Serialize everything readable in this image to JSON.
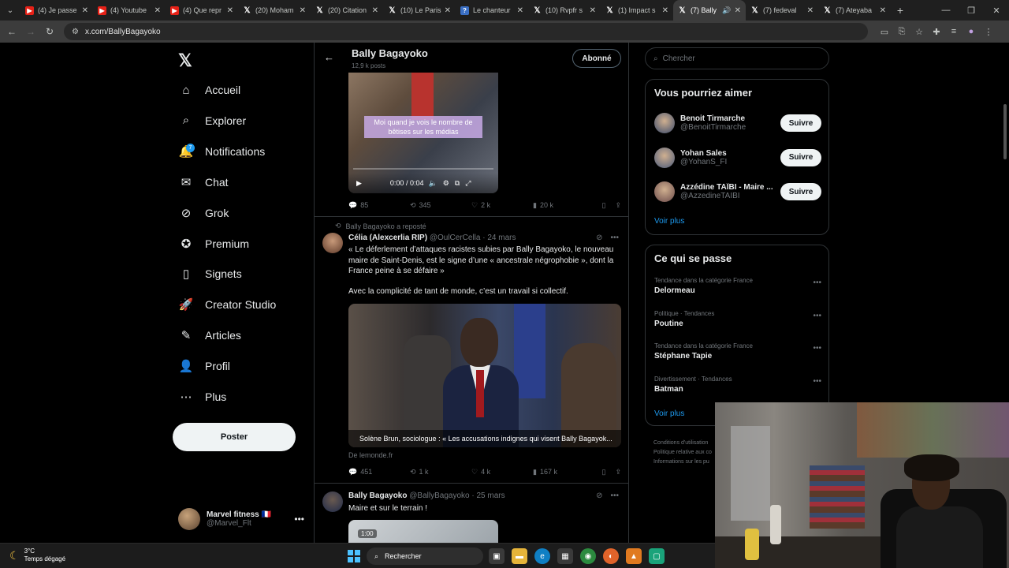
{
  "browser": {
    "tabs": [
      {
        "favicon": "youtube-icon",
        "label": "(4) Je passe"
      },
      {
        "favicon": "youtube-icon",
        "label": "(4) Youtube"
      },
      {
        "favicon": "youtube-icon",
        "label": "(4) Que repr"
      },
      {
        "favicon": "x-icon",
        "label": "(20) Moham"
      },
      {
        "favicon": "x-icon",
        "label": "(20) Citation"
      },
      {
        "favicon": "x-icon",
        "label": "(10) Le Paris"
      },
      {
        "favicon": "wiki-icon",
        "label": "Le chanteur"
      },
      {
        "favicon": "x-icon",
        "label": "(10) Rvpfr s"
      },
      {
        "favicon": "x-icon",
        "label": "(1) Impact s"
      },
      {
        "favicon": "x-icon",
        "label": "(7) Bally"
      },
      {
        "favicon": "x-icon",
        "label": "(7) fedeval"
      },
      {
        "favicon": "x-icon",
        "label": "(7) Ateyaba"
      }
    ],
    "active_tab_index": 9,
    "url": "x.com/BallyBagayoko"
  },
  "nav": {
    "items": [
      {
        "label": "Accueil",
        "icon": "home-icon"
      },
      {
        "label": "Explorer",
        "icon": "search-icon"
      },
      {
        "label": "Notifications",
        "icon": "bell-icon",
        "badge": "7"
      },
      {
        "label": "Chat",
        "icon": "mail-icon"
      },
      {
        "label": "Grok",
        "icon": "grok-icon"
      },
      {
        "label": "Premium",
        "icon": "premium-icon"
      },
      {
        "label": "Signets",
        "icon": "bookmark-icon"
      },
      {
        "label": "Creator Studio",
        "icon": "rocket-icon"
      },
      {
        "label": "Articles",
        "icon": "articles-icon"
      },
      {
        "label": "Profil",
        "icon": "profile-icon"
      },
      {
        "label": "Plus",
        "icon": "more-circle-icon"
      }
    ],
    "post_label": "Poster",
    "account": {
      "name": "Marvel fitness 🇫🇷",
      "handle": "@Marvel_Flt"
    }
  },
  "profile_header": {
    "name": "Bally Bagayoko",
    "posts": "12,9 k posts",
    "follow_label": "Abonné"
  },
  "tweet1": {
    "video_caption": "Moi quand je vois le nombre de bêtises sur les médias",
    "video_time": "0:00 / 0:04",
    "replies": "85",
    "reposts": "345",
    "likes": "2 k",
    "views": "20 k"
  },
  "tweet2": {
    "repost_note": "Bally Bagayoko a reposté",
    "author": "Célia (Alexcerlia RIP)",
    "handle": "@OulCerCella",
    "date": "· 24 mars",
    "text1": "« Le déferlement d’attaques racistes subies par Bally Bagayoko, le nouveau maire de Saint-Denis, est le signe d’une « ancestrale négrophobie », dont la France peine à se défaire »",
    "text2": "Avec la complicité de tant de monde, c’est un travail si collectif.",
    "media_caption": "Solène Brun, sociologue : « Les accusations indignes qui visent Bally Bagayok...",
    "source": "De lemonde.fr",
    "replies": "451",
    "reposts": "1 k",
    "likes": "4 k",
    "views": "167 k"
  },
  "tweet3": {
    "author": "Bally Bagayoko",
    "handle": "@BallyBagayoko",
    "date": "· 25 mars",
    "text": "Maire et sur le terrain !",
    "media_tag": "1:00"
  },
  "sidebar": {
    "search_placeholder": "Chercher",
    "suggestions_title": "Vous pourriez aimer",
    "suggestions": [
      {
        "name": "Benoit Tirmarche",
        "handle": "@BenoitTirmarche"
      },
      {
        "name": "Yohan Sales",
        "handle": "@YohanS_FI"
      },
      {
        "name": "Azzédine TAÏBI - Maire ...",
        "handle": "@AzzedineTAIBI"
      }
    ],
    "follow_label": "Suivre",
    "see_more": "Voir plus",
    "trends_title": "Ce qui se passe",
    "trends": [
      {
        "meta": "Tendance dans la catégorie France",
        "name": "Delormeau"
      },
      {
        "meta": "Politique · Tendances",
        "name": "Poutine"
      },
      {
        "meta": "Tendance dans la catégorie France",
        "name": "Stéphane Tapie"
      },
      {
        "meta": "Divertissement · Tendances",
        "name": "Batman"
      }
    ],
    "footer": [
      "Conditions d'utilisation",
      "Politique relative aux co",
      "Informations sur les pu"
    ]
  },
  "taskbar": {
    "temperature": "3°C",
    "weather": "Temps dégagé",
    "search_label": "Rechercher"
  }
}
